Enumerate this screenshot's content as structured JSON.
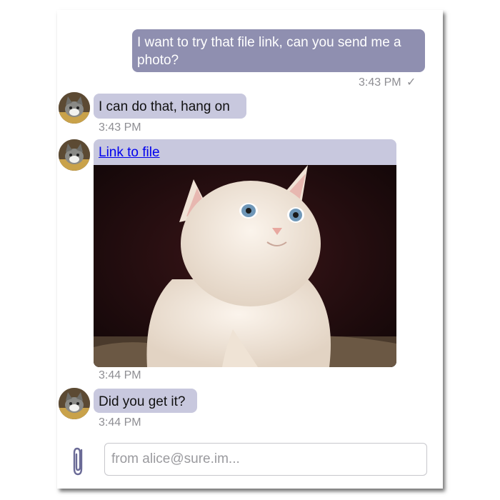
{
  "messages": [
    {
      "direction": "out",
      "text": "I want to try that file link, can you send me a photo?",
      "time": "3:43 PM",
      "status": "✓"
    },
    {
      "direction": "in",
      "text": "I can do that, hang on",
      "time": "3:43 PM"
    },
    {
      "direction": "in",
      "type": "attachment",
      "link_text": "Link to file",
      "time": "3:44 PM"
    },
    {
      "direction": "in",
      "text": "Did you get it?",
      "time": "3:44 PM"
    }
  ],
  "composer": {
    "placeholder": "from alice@sure.im..."
  },
  "colors": {
    "outgoing_bubble": "#8f8fb0",
    "incoming_bubble": "#c8c8de",
    "link": "#0000ee",
    "timestamp": "#8e8e93"
  },
  "icons": {
    "attach": "paperclip-icon",
    "read_status": "checkmark-icon"
  }
}
